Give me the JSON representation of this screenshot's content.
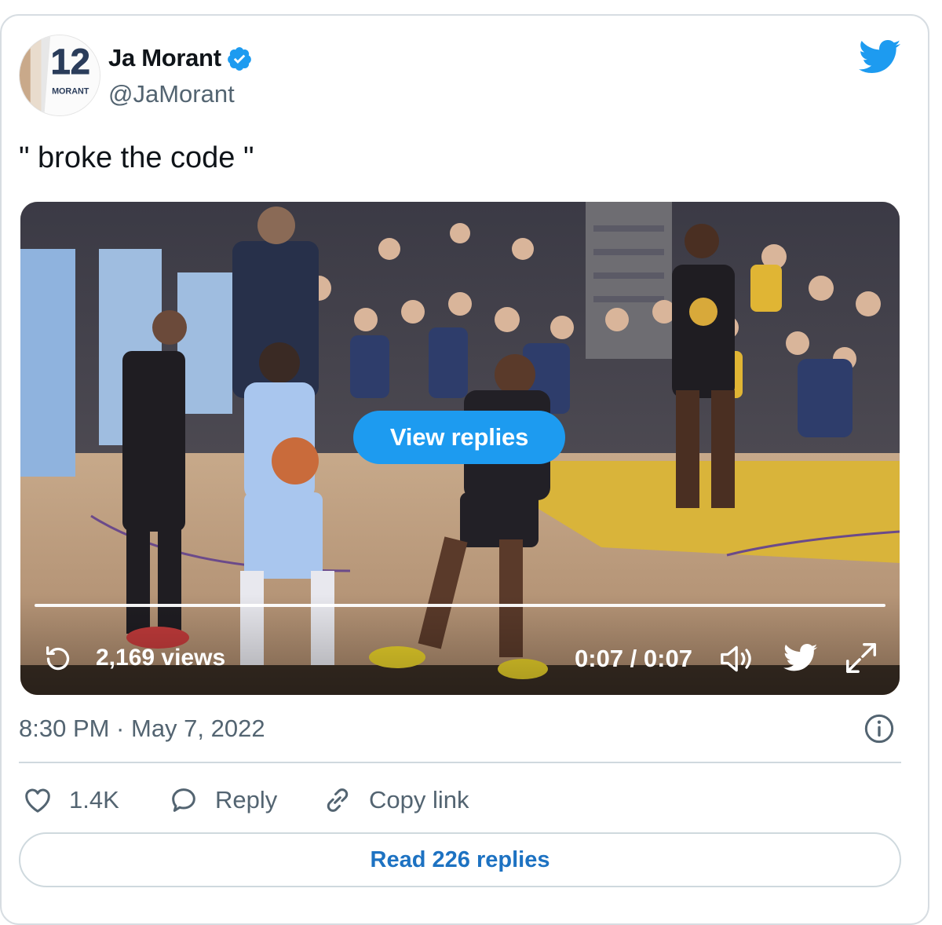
{
  "author": {
    "display_name": "Ja Morant",
    "handle": "@JaMorant",
    "verified": true,
    "avatar_jersey_number": "12",
    "avatar_jersey_name": "MORANT"
  },
  "tweet": {
    "text": "\" broke the code \""
  },
  "video": {
    "view_replies_label": "View replies",
    "views_label": "2,169 views",
    "time_label": "0:07 / 0:07",
    "progress_fraction": 1.0
  },
  "meta": {
    "timestamp": "8:30 PM · May 7, 2022"
  },
  "actions": {
    "like_count": "1.4K",
    "reply_label": "Reply",
    "copy_link_label": "Copy link"
  },
  "footer": {
    "read_replies_label": "Read 226 replies"
  },
  "icons": {
    "twitter_logo": "twitter-bird-icon",
    "verified": "verified-badge-icon",
    "replay": "replay-icon",
    "volume": "volume-icon",
    "expand": "expand-icon",
    "info": "info-icon",
    "like": "heart-icon",
    "reply": "speech-bubble-icon",
    "copy": "link-icon"
  },
  "colors": {
    "accent": "#1d9bf0",
    "read_replies_text": "#1d72c2",
    "muted_text": "#536471",
    "border": "#cfd9de"
  }
}
